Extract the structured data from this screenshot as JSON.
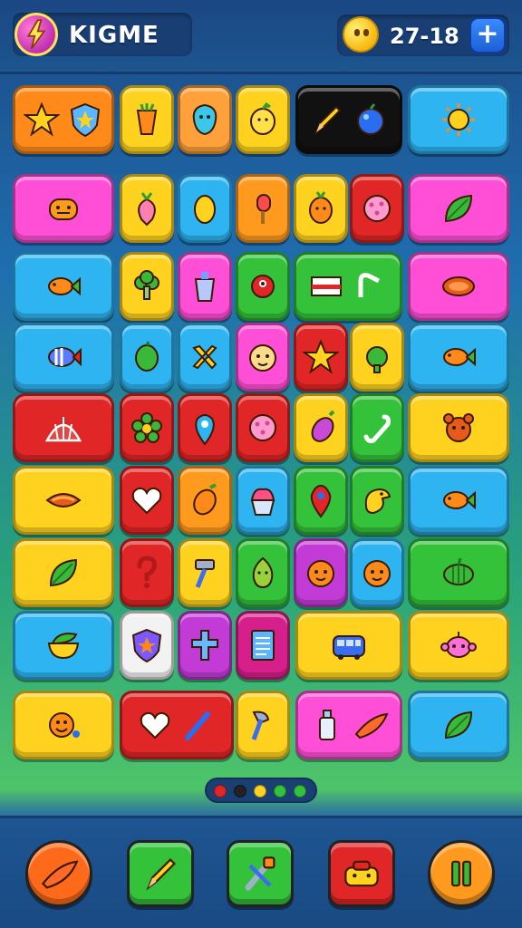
{
  "header": {
    "logo_title": "KIGME",
    "coin_value": "27-18",
    "add_label": "+"
  },
  "board": {
    "rows": [
      [
        {
          "name": "star-shield-tile",
          "color": "#ff8a1a",
          "icons": [
            "star-icon",
            "shield-icon"
          ]
        },
        {
          "name": "carrot-tile",
          "color": "#ffd21f",
          "icons": [
            "carrot-icon"
          ]
        },
        {
          "name": "blob-tile",
          "color": "#ffa13a",
          "icons": [
            "blob-icon"
          ]
        },
        {
          "name": "lemon-tile",
          "color": "#ffd21f",
          "icons": [
            "lemon-icon"
          ]
        },
        {
          "name": "pencil-berry-tile",
          "color": "#111111",
          "icons": [
            "pencil-icon",
            "berry-icon"
          ]
        },
        {
          "name": "sun-tile",
          "color": "#2fb4f2",
          "icons": [
            "sun-icon"
          ]
        }
      ],
      [
        {
          "name": "monster-tile",
          "color": "#ff4fd6",
          "icons": [
            "monster-icon"
          ]
        },
        {
          "name": "radish-tile",
          "color": "#ffd21f",
          "icons": [
            "radish-icon"
          ]
        },
        {
          "name": "egg-tile",
          "color": "#2fb4f2",
          "icons": [
            "egg-icon"
          ]
        },
        {
          "name": "popsicle-tile",
          "color": "#ff9a1f",
          "icons": [
            "popsicle-icon"
          ]
        },
        {
          "name": "carrot-face-tile",
          "color": "#ffd21f",
          "icons": [
            "carrot-face-icon"
          ]
        },
        {
          "name": "cookie-tile",
          "color": "#e02626",
          "icons": [
            "cookie-icon"
          ]
        },
        {
          "name": "leaf-tile",
          "color": "#ff4fd6",
          "icons": [
            "leaf-icon"
          ]
        }
      ],
      [
        {
          "name": "fish-tile",
          "color": "#2fb4f2",
          "icons": [
            "fish-icon"
          ]
        },
        {
          "name": "broccoli-tile",
          "color": "#ffd21f",
          "icons": [
            "broccoli-icon"
          ]
        },
        {
          "name": "cup-tile",
          "color": "#ff4fd6",
          "icons": [
            "cup-icon"
          ]
        },
        {
          "name": "critter-tile",
          "color": "#34c23b",
          "icons": [
            "critter-icon"
          ]
        },
        {
          "name": "flag-pin-tile",
          "color": "#34c23b",
          "icons": [
            "flag-icon",
            "pin-icon"
          ]
        },
        {
          "name": "papaya-tile",
          "color": "#ff4fd6",
          "icons": [
            "papaya-icon"
          ]
        }
      ],
      [
        {
          "name": "striped-fish-tile",
          "color": "#2fb4f2",
          "icons": [
            "striped-fish-icon"
          ]
        },
        {
          "name": "lime-tile",
          "color": "#2fb4f2",
          "icons": [
            "lime-icon"
          ]
        },
        {
          "name": "cross-tile",
          "color": "#2fb4f2",
          "icons": [
            "cross-icon"
          ]
        },
        {
          "name": "face-tile",
          "color": "#ff4fd6",
          "icons": [
            "face-icon"
          ]
        },
        {
          "name": "red-star-tile",
          "color": "#e02626",
          "icons": [
            "star-icon"
          ]
        },
        {
          "name": "apple-tile",
          "color": "#ffd21f",
          "icons": [
            "apple-icon"
          ]
        },
        {
          "name": "gold-fish-tile",
          "color": "#2fb4f2",
          "icons": [
            "fish-icon"
          ]
        }
      ],
      [
        {
          "name": "tent-tile",
          "color": "#e02626",
          "icons": [
            "tent-icon"
          ]
        },
        {
          "name": "flower-tile",
          "color": "#e02626",
          "icons": [
            "flower-icon"
          ]
        },
        {
          "name": "drop-tile",
          "color": "#e02626",
          "icons": [
            "drop-icon"
          ]
        },
        {
          "name": "berry-cookie-tile",
          "color": "#e02626",
          "icons": [
            "cookie-icon"
          ]
        },
        {
          "name": "eggplant-tile",
          "color": "#ffd21f",
          "icons": [
            "eggplant-icon"
          ]
        },
        {
          "name": "hook-tile",
          "color": "#34c23b",
          "icons": [
            "hook-icon"
          ]
        },
        {
          "name": "bear-tile",
          "color": "#ffd21f",
          "icons": [
            "bear-icon"
          ]
        }
      ],
      [
        {
          "name": "melon-slice-tile",
          "color": "#ffd21f",
          "icons": [
            "melon-icon"
          ]
        },
        {
          "name": "heart-tile",
          "color": "#e02626",
          "icons": [
            "heart-icon"
          ]
        },
        {
          "name": "mango-tile",
          "color": "#ff9a1f",
          "icons": [
            "mango-icon"
          ]
        },
        {
          "name": "cupcake-tile",
          "color": "#2fb4f2",
          "icons": [
            "cupcake-icon"
          ]
        },
        {
          "name": "map-pin-tile",
          "color": "#34c23b",
          "icons": [
            "map-pin-icon"
          ]
        },
        {
          "name": "bird-tile",
          "color": "#34c23b",
          "icons": [
            "bird-icon"
          ]
        },
        {
          "name": "rainbow-fish-tile",
          "color": "#2fb4f2",
          "icons": [
            "fish-icon"
          ]
        }
      ],
      [
        {
          "name": "spinach-tile",
          "color": "#ffd21f",
          "icons": [
            "leaf-icon"
          ]
        },
        {
          "name": "question-tile",
          "color": "#e02626",
          "icons": [
            "question-icon"
          ]
        },
        {
          "name": "hammer-tile",
          "color": "#ffd21f",
          "icons": [
            "hammer-icon"
          ]
        },
        {
          "name": "avocado-tile",
          "color": "#34c23b",
          "icons": [
            "avocado-icon"
          ]
        },
        {
          "name": "orange-face-tile",
          "color": "#c23bd6",
          "icons": [
            "orange-face-icon"
          ]
        },
        {
          "name": "orange-smile-tile",
          "color": "#2fb4f2",
          "icons": [
            "orange-face-icon"
          ]
        },
        {
          "name": "gourd-tile",
          "color": "#34c23b",
          "icons": [
            "gourd-icon"
          ]
        }
      ],
      [
        {
          "name": "bowl-tile",
          "color": "#2fb4f2",
          "icons": [
            "bowl-icon"
          ]
        },
        {
          "name": "badge-tile",
          "color": "#f2f2f2",
          "icons": [
            "badge-icon"
          ]
        },
        {
          "name": "grave-tile",
          "color": "#c23bd6",
          "icons": [
            "grave-cross-icon"
          ]
        },
        {
          "name": "note-tile",
          "color": "#d61f8a",
          "icons": [
            "note-icon"
          ]
        },
        {
          "name": "bus-tile",
          "color": "#ffd21f",
          "icons": [
            "bus-icon"
          ]
        },
        {
          "name": "robot-tile",
          "color": "#ffd21f",
          "icons": [
            "robot-icon"
          ]
        }
      ],
      [
        {
          "name": "smiley-tile",
          "color": "#ffd21f",
          "icons": [
            "smiley-icon"
          ]
        },
        {
          "name": "heart-wand-tile",
          "color": "#e02626",
          "icons": [
            "heart-icon",
            "wand-icon"
          ]
        },
        {
          "name": "axe-tile",
          "color": "#ffd21f",
          "icons": [
            "axe-icon"
          ]
        },
        {
          "name": "paint-tile",
          "color": "#ff4fd6",
          "icons": [
            "bottle-icon",
            "brush-icon"
          ]
        },
        {
          "name": "green-leaf-tile",
          "color": "#2fb4f2",
          "icons": [
            "leaf-icon"
          ]
        }
      ]
    ]
  },
  "pager": {
    "dots": [
      "#e02626",
      "#222222",
      "#ffd21f",
      "#34c23b",
      "#34c23b"
    ]
  },
  "dock": {
    "buttons": [
      {
        "name": "dock-brush-button",
        "icon": "brush-icon",
        "color": "#ff6a1a",
        "shape": "round"
      },
      {
        "name": "dock-pencil-button",
        "icon": "pencil-icon",
        "color": "#34c23b",
        "shape": "square"
      },
      {
        "name": "dock-tools-button",
        "icon": "tools-icon",
        "color": "#34c23b",
        "shape": "square"
      },
      {
        "name": "dock-chest-button",
        "icon": "chest-icon",
        "color": "#e02626",
        "shape": "square"
      },
      {
        "name": "dock-pause-button",
        "icon": "pause-icon",
        "color": "#ff9a1f",
        "shape": "round"
      }
    ]
  }
}
